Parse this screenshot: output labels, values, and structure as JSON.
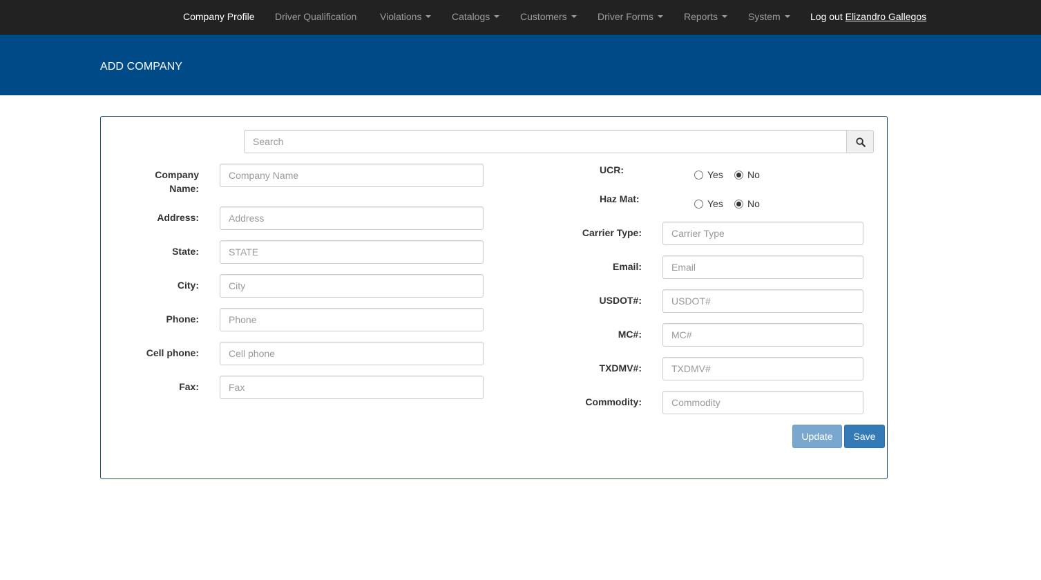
{
  "navbar": {
    "items": [
      {
        "label": "Company Profile",
        "active": true,
        "dropdown": false
      },
      {
        "label": "Driver Qualification",
        "active": false,
        "dropdown": false
      },
      {
        "label": "Violations",
        "active": false,
        "dropdown": true
      },
      {
        "label": "Catalogs",
        "active": false,
        "dropdown": true
      },
      {
        "label": "Customers",
        "active": false,
        "dropdown": true
      },
      {
        "label": "Driver Forms",
        "active": false,
        "dropdown": true
      },
      {
        "label": "Reports",
        "active": false,
        "dropdown": true
      },
      {
        "label": "System",
        "active": false,
        "dropdown": true
      }
    ],
    "logout_label": "Log out",
    "user_name": "Elizandro Gallegos"
  },
  "header": {
    "title": "ADD COMPANY"
  },
  "search": {
    "placeholder": "Search",
    "value": "",
    "icon": "search-icon"
  },
  "left_fields": [
    {
      "label_line1": "Company",
      "label_line2": "Name:",
      "placeholder": "Company Name"
    },
    {
      "label": "Address:",
      "placeholder": "Address"
    },
    {
      "label": "State:",
      "placeholder": "STATE"
    },
    {
      "label": "City:",
      "placeholder": "City"
    },
    {
      "label": "Phone:",
      "placeholder": "Phone"
    },
    {
      "label": "Cell phone:",
      "placeholder": "Cell phone"
    },
    {
      "label": "Fax:",
      "placeholder": "Fax"
    }
  ],
  "radio_groups": [
    {
      "label": "UCR:",
      "yes_label": "Yes",
      "no_label": "No",
      "selected": "No"
    },
    {
      "label": "Haz Mat:",
      "yes_label": "Yes",
      "no_label": "No",
      "selected": "No"
    }
  ],
  "right_fields": [
    {
      "label": "Carrier Type:",
      "placeholder": "Carrier Type"
    },
    {
      "label": "Email:",
      "placeholder": "Email"
    },
    {
      "label": "USDOT#:",
      "placeholder": "USDOT#"
    },
    {
      "label": "MC#:",
      "placeholder": "MC#"
    },
    {
      "label": "TXDMV#:",
      "placeholder": "TXDMV#"
    },
    {
      "label": "Commodity:",
      "placeholder": "Commodity"
    }
  ],
  "buttons": {
    "update_label": "Update",
    "save_label": "Save"
  },
  "colors": {
    "navbar_bg": "#222222",
    "header_bg": "#004a87",
    "primary": "#337ab7",
    "primary_disabled": "#7aa7cf",
    "panel_border": "#1f4e6b"
  }
}
